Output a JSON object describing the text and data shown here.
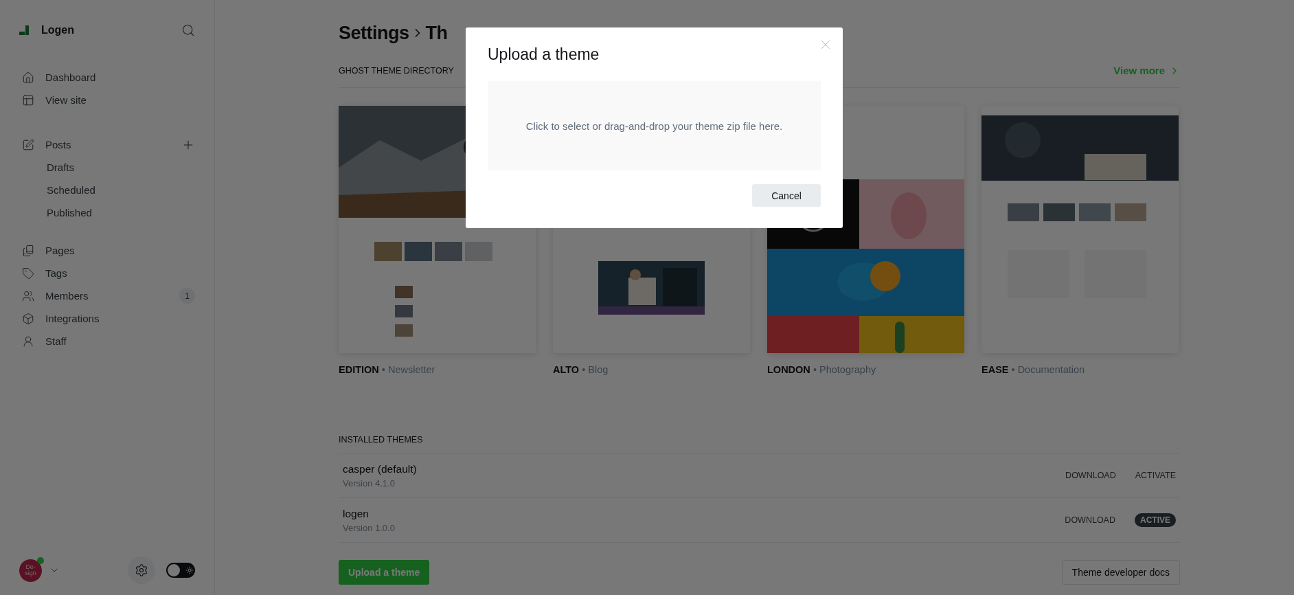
{
  "sidebar": {
    "site_name": "Logen",
    "nav": [
      {
        "kind": "home",
        "label": "Dashboard"
      },
      {
        "kind": "site",
        "label": "View site"
      }
    ],
    "content": [
      {
        "kind": "posts",
        "label": "Posts",
        "add": true,
        "children": [
          {
            "label": "Drafts"
          },
          {
            "label": "Scheduled"
          },
          {
            "label": "Published"
          }
        ]
      },
      {
        "kind": "pages",
        "label": "Pages"
      },
      {
        "kind": "tags",
        "label": "Tags"
      },
      {
        "kind": "members",
        "label": "Members",
        "badge": "1"
      },
      {
        "kind": "integrations",
        "label": "Integrations"
      },
      {
        "kind": "staff",
        "label": "Staff"
      }
    ],
    "avatar_text": "De-sign",
    "online": true,
    "dark_mode": false
  },
  "header": {
    "title": "Settings",
    "current": "Th"
  },
  "directory": {
    "heading": "GHOST THEME DIRECTORY",
    "view_more": "View more",
    "themes": [
      {
        "name": "EDITION",
        "separator": "•",
        "category": "Newsletter"
      },
      {
        "name": "ALTO",
        "separator": "•",
        "category": "Blog"
      },
      {
        "name": "LONDON",
        "separator": "•",
        "category": "Photography"
      },
      {
        "name": "EASE",
        "separator": "•",
        "category": "Documentation"
      }
    ]
  },
  "installed": {
    "heading": "INSTALLED THEMES",
    "rows": [
      {
        "name": "casper (default)",
        "version": "Version 4.1.0",
        "download": "DOWNLOAD",
        "status": "ACTIVATE",
        "active": false
      },
      {
        "name": "logen",
        "version": "Version 1.0.0",
        "download": "DOWNLOAD",
        "status": "ACTIVE",
        "active": true
      }
    ],
    "upload": "Upload a theme",
    "docs": "Theme developer docs"
  },
  "modal": {
    "title": "Upload a theme",
    "dropzone": "Click to select or drag-and-drop your theme zip file here.",
    "cancel": "Cancel"
  }
}
